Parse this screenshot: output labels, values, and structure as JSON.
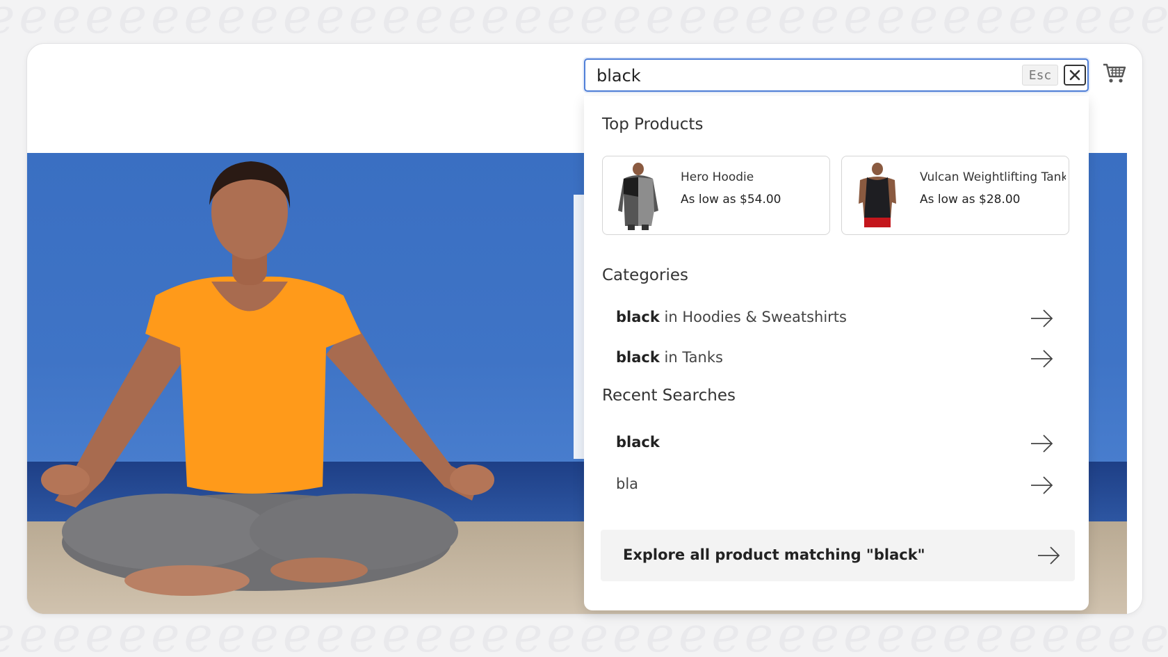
{
  "search": {
    "value": "black",
    "esc_label": "Esc"
  },
  "sections": {
    "top_products": "Top Products",
    "categories": "Categories",
    "recent_searches": "Recent Searches"
  },
  "products": [
    {
      "name": "Hero Hoodie",
      "price": "As low as $54.00"
    },
    {
      "name": "Vulcan Weightlifting Tank",
      "price": "As low as $28.00"
    }
  ],
  "categories": [
    {
      "term": "black",
      "suffix": " in Hoodies & Sweatshirts"
    },
    {
      "term": "black",
      "suffix": " in Tanks"
    }
  ],
  "recent": [
    {
      "term": "black",
      "bold": true
    },
    {
      "term": "bla",
      "bold": false
    }
  ],
  "explore_label": "Explore all product matching \"black\"",
  "icons": {
    "close": "close-icon",
    "cart": "cart-icon",
    "arrow": "arrow-right-icon"
  },
  "colors": {
    "focus_border": "#4f7fd8",
    "hero_sky": "#3f74c6",
    "shirt": "#ff9a1a"
  }
}
